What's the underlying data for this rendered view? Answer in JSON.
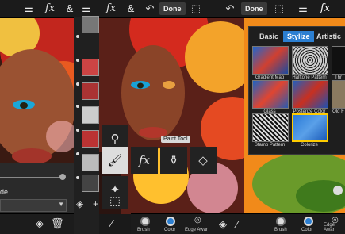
{
  "colors": {
    "accent": "#2c7fd1",
    "panel_orange": "#f18a1a",
    "selected_filter": "#ffcc00"
  },
  "left_panel": {
    "partial_label": "de",
    "icons": [
      "fx-icon",
      "ampersand-icon",
      "layers-add-icon",
      "trash-icon"
    ]
  },
  "middle_panel": {
    "toolbar": {
      "done_label": "Done"
    },
    "tooltip": "Paint Tool",
    "bottom": {
      "brush_label": "Brush",
      "color_label": "Color",
      "edge_label": "Edge Awar"
    }
  },
  "right_panel": {
    "toolbar": {
      "done_label": "Done"
    },
    "tabs": [
      "Basic",
      "Stylize",
      "Artistic"
    ],
    "selected_tab": "Stylize",
    "filters": [
      {
        "label": "Gradient Map"
      },
      {
        "label": "Halftone Pattern"
      },
      {
        "label": "Thr"
      },
      {
        "label": "Glass"
      },
      {
        "label": "Posterize Color"
      },
      {
        "label": "Old F"
      },
      {
        "label": "Stamp Pattern"
      },
      {
        "label": "Colorize"
      }
    ],
    "bottom": {
      "brush_label": "Brush",
      "color_label": "Color",
      "edge_label": "Edge Awar"
    }
  }
}
